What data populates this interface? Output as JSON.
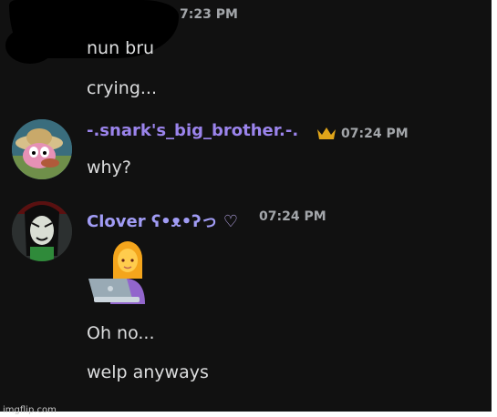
{
  "messages": [
    {
      "time": "7:23 PM",
      "lines": [
        "nun bru",
        "crying..."
      ]
    },
    {
      "username": "-.snark's_big_brother.-.",
      "username_color": "#9b84ec",
      "badge_icon": "crown-icon",
      "time": "07:24 PM",
      "lines": [
        "why?"
      ]
    },
    {
      "username": "Clover ʕ•ᴥ•ʔっ",
      "username_color": "#a19cf5",
      "suffix_icon": "heart-icon",
      "time": "07:24 PM",
      "emoji": "woman-technologist-emoji",
      "lines": [
        "Oh no...",
        "welp anyways"
      ]
    }
  ],
  "watermark": "imgflip.com",
  "colors": {
    "background": "#111111",
    "text": "#dcddde",
    "timestamp": "#a3a6aa",
    "crown": "#e0a51a"
  }
}
